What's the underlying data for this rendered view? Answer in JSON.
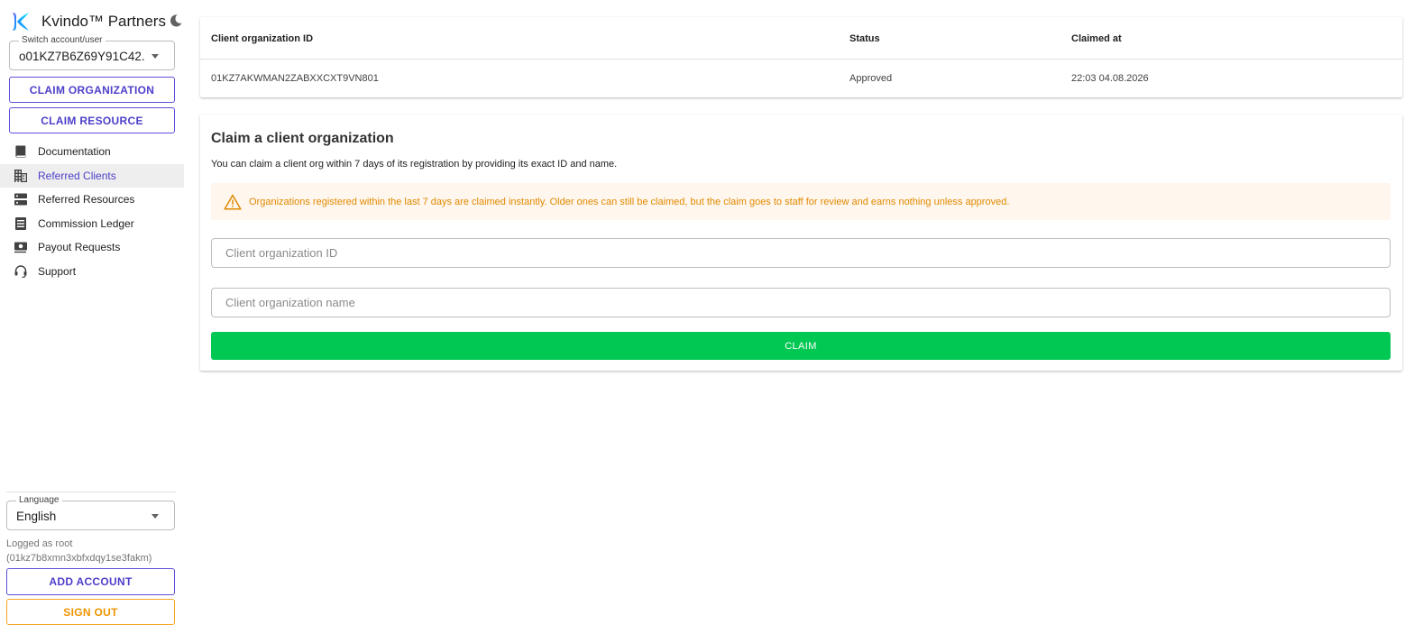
{
  "app": {
    "title": "Kvindo™ Partners"
  },
  "sidebar": {
    "account_switcher": {
      "label": "Switch account/user",
      "value": "o01KZ7B6Z69Y91C42..."
    },
    "claim_organization_label": "CLAIM ORGANIZATION",
    "claim_resource_label": "CLAIM RESOURCE",
    "nav_items": [
      {
        "label": "Documentation",
        "icon": "book-icon",
        "active": false
      },
      {
        "label": "Referred Clients",
        "icon": "building-icon",
        "active": true
      },
      {
        "label": "Referred Resources",
        "icon": "server-icon",
        "active": false
      },
      {
        "label": "Commission Ledger",
        "icon": "ledger-icon",
        "active": false
      },
      {
        "label": "Payout Requests",
        "icon": "payout-icon",
        "active": false
      },
      {
        "label": "Support",
        "icon": "headset-icon",
        "active": false
      }
    ],
    "language": {
      "label": "Language",
      "value": "English"
    },
    "logged_as": "Logged as root",
    "logged_id": "(01kz7b8xmn3xbfxdqy1se3fakm)",
    "add_account_label": "ADD ACCOUNT",
    "sign_out_label": "SIGN OUT"
  },
  "clients_table": {
    "headers": [
      "Client organization ID",
      "Status",
      "Claimed at"
    ],
    "rows": [
      [
        "01KZ7AKWMAN2ZABXXCXT9VN801",
        "Approved",
        "22:03 04.08.2026"
      ]
    ]
  },
  "claim_form": {
    "title": "Claim a client organization",
    "description": "You can claim a client org within 7 days of its registration by providing its exact ID and name.",
    "warning": "Organizations registered within the last 7 days are claimed instantly. Older ones can still be claimed, but the claim goes to staff for review and earns nothing unless approved.",
    "org_id_placeholder": "Client organization ID",
    "org_id_value": "",
    "org_name_placeholder": "Client organization name",
    "org_name_value": "",
    "submit_label": "CLAIM"
  },
  "colors": {
    "accent": "#4d3fc9",
    "success": "#00c853",
    "warning": "#e08a00",
    "warning_bg": "#fff6ee",
    "sign_out": "#ef9400"
  }
}
